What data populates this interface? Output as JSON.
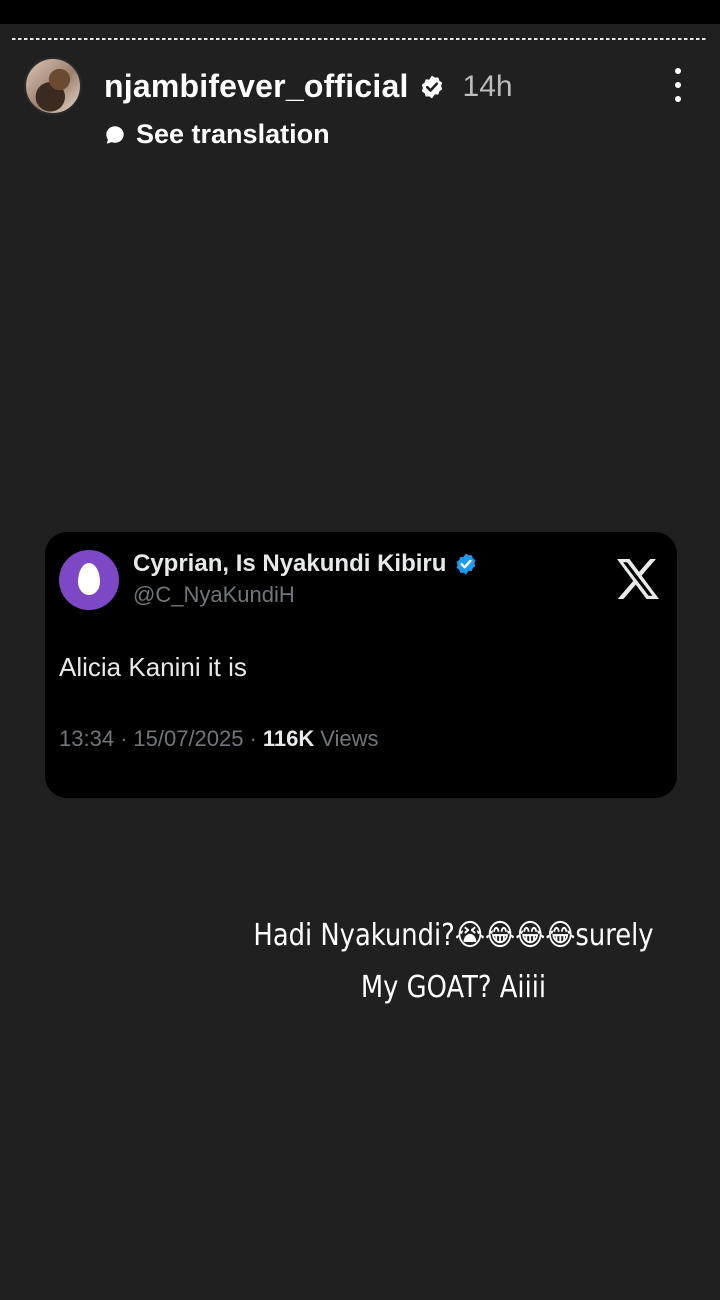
{
  "story": {
    "username": "njambifever_official",
    "time": "14h",
    "translation_label": "See translation",
    "progress_segments": 3
  },
  "tweet": {
    "name": "Cyprian, Is Nyakundi Kibiru",
    "handle": "@C_NyaKundiH",
    "text": "Alicia Kanini it is",
    "time": "13:34",
    "date": "15/07/2025",
    "views_count": "116K",
    "views_label": "Views",
    "separator": "·"
  },
  "caption": {
    "line1": "Hadi Nyakundi?😭😂😂😂surely",
    "line2": "My GOAT? Aiiii"
  },
  "colors": {
    "story_background": "#202020",
    "card_background": "#000000",
    "verified_blue": "#1d9bf0",
    "tweet_avatar": "#7d48c6"
  },
  "icons": {
    "verified": "verified-badge-icon",
    "translate": "speech-bubble-icon",
    "more": "more-vertical-icon",
    "x_logo": "x-logo-icon"
  }
}
